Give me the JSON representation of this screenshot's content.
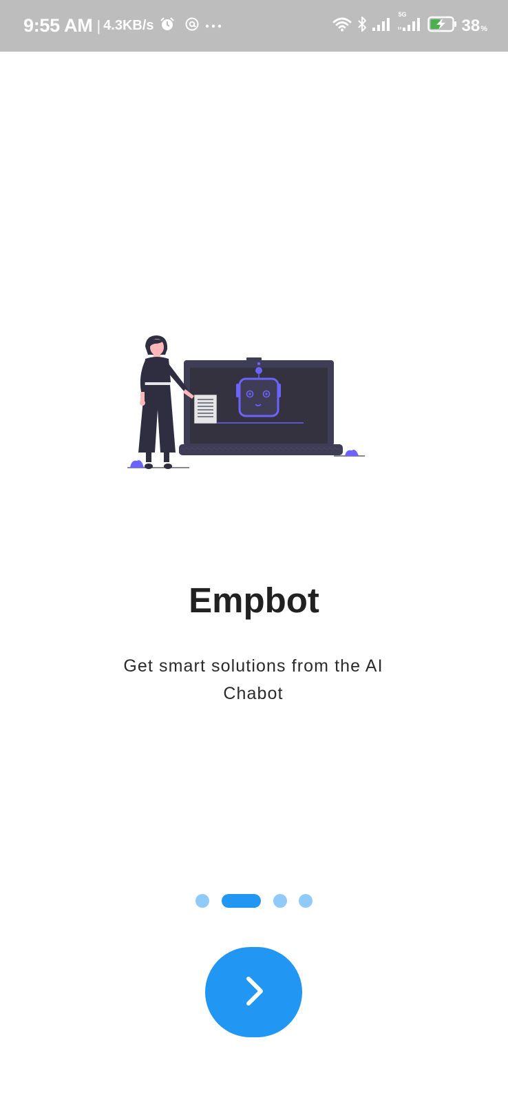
{
  "status_bar": {
    "time": "9:55 AM",
    "separator": "|",
    "network_speed": "4.3KB/s",
    "network_type": "5G",
    "battery_percent": "38",
    "battery_unit": "%",
    "icons": [
      "alarm-icon",
      "at-sign-icon",
      "more-dots-icon",
      "wifi-icon",
      "bluetooth-icon",
      "signal-icon",
      "signal-5g-icon",
      "battery-charging-icon"
    ]
  },
  "onboarding": {
    "illustration": "woman-presenting-chatbot-on-laptop",
    "title": "Empbot",
    "subtitle": "Get smart solutions from the AI Chabot",
    "page_indicator": {
      "current_page": 2,
      "total_pages": 4
    },
    "next_button": {
      "icon": "chevron-right-icon"
    }
  },
  "colors": {
    "primary": "#2196f3",
    "indicator_inactive": "#90caf9",
    "illustration_dark": "#3f3d56",
    "illustration_accent": "#6c63ff",
    "status_bar": "#bdbdbd"
  }
}
